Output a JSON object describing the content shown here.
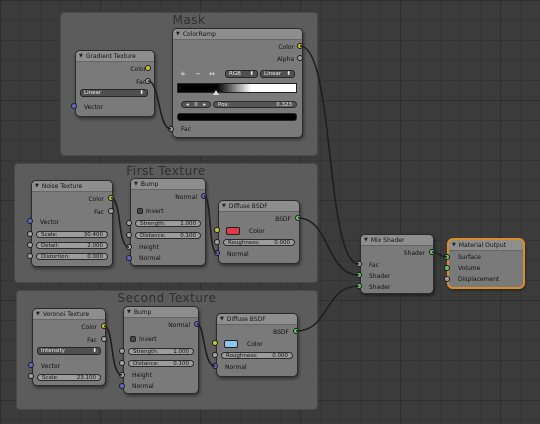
{
  "frames": {
    "mask": "Mask",
    "first": "First Texture",
    "second": "Second Texture"
  },
  "gradient_texture": {
    "title": "Gradient Texture",
    "out_color": "Color",
    "out_fac": "Fac",
    "type": "Linear",
    "in_vector": "Vector"
  },
  "color_ramp": {
    "title": "ColorRamp",
    "out_color": "Color",
    "out_alpha": "Alpha",
    "btn_add": "+",
    "btn_remove": "−",
    "btn_flip": "↔",
    "mode": "RGB",
    "interp": "Linear",
    "index": "0",
    "pos_label": "Pos:",
    "pos_value": "0.323",
    "in_fac": "Fac"
  },
  "noise_texture": {
    "title": "Noise Texture",
    "out_color": "Color",
    "out_fac": "Fac",
    "in_vector": "Vector",
    "scale_label": "Scale:",
    "scale_value": "30.400",
    "detail_label": "Detail:",
    "detail_value": "2.000",
    "distortion_label": "Distortion:",
    "distortion_value": "0.000"
  },
  "bump1": {
    "title": "Bump",
    "out_normal": "Normal",
    "invert": "Invert",
    "strength_label": "Strength:",
    "strength_value": "1.000",
    "distance_label": "Distance:",
    "distance_value": "0.100",
    "in_height": "Height",
    "in_normal": "Normal"
  },
  "diffuse1": {
    "title": "Diffuse BSDF",
    "out_bsdf": "BSDF",
    "in_color": "Color",
    "swatch": "#e03a4a",
    "rough_label": "Roughness:",
    "rough_value": "0.000",
    "in_normal": "Normal"
  },
  "mix_shader": {
    "title": "Mix Shader",
    "out_shader": "Shader",
    "in_fac": "Fac",
    "in_shader1": "Shader",
    "in_shader2": "Shader"
  },
  "material_output": {
    "title": "Material Output",
    "in_surface": "Surface",
    "in_volume": "Volume",
    "in_displacement": "Displacement"
  },
  "voronoi": {
    "title": "Voronoi Texture",
    "out_color": "Color",
    "out_fac": "Fac",
    "coloring": "Intensity",
    "in_vector": "Vector",
    "scale_label": "Scale:",
    "scale_value": "23.100"
  },
  "bump2": {
    "title": "Bump",
    "out_normal": "Normal",
    "invert": "Invert",
    "strength_label": "Strength:",
    "strength_value": "1.000",
    "distance_label": "Distance:",
    "distance_value": "0.100",
    "in_height": "Height",
    "in_normal": "Normal"
  },
  "diffuse2": {
    "title": "Diffuse BSDF",
    "out_bsdf": "BSDF",
    "in_color": "Color",
    "swatch": "#8fc6f0",
    "rough_label": "Roughness:",
    "rough_value": "0.000",
    "in_normal": "Normal"
  }
}
